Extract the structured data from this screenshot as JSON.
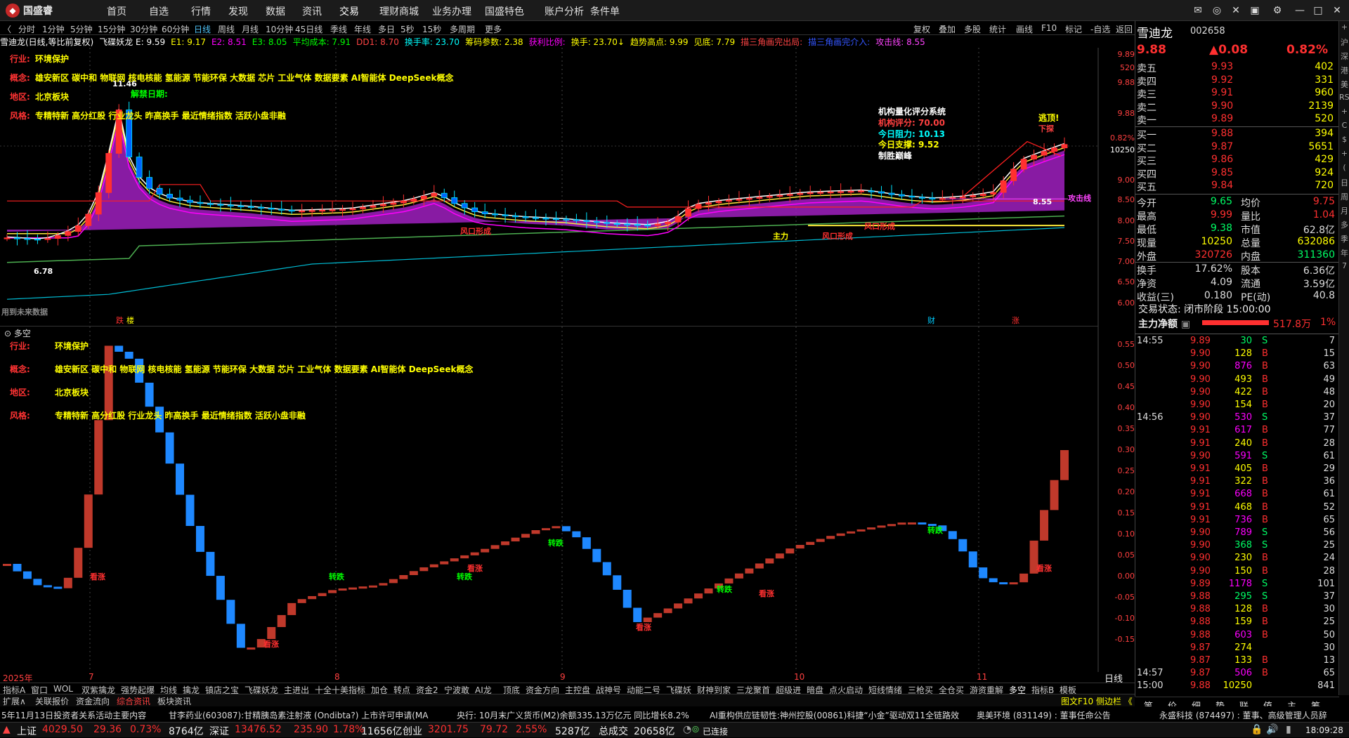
{
  "app": {
    "brand": "国盛睿",
    "menu": [
      "首页",
      "自选",
      "行情",
      "发现",
      "数据",
      "资讯",
      "交易",
      "理财商城",
      "业务办理",
      "国盛特色",
      "账户分析",
      "条件单"
    ],
    "active_menu": "交易"
  },
  "periods": [
    "分时",
    "1分钟",
    "5分钟",
    "15分钟",
    "30分钟",
    "60分钟",
    "日线",
    "周线",
    "月线",
    "10分钟",
    "45日线",
    "季线",
    "年线",
    "多日",
    "5秒",
    "15秒",
    "多周期",
    "更多"
  ],
  "active_period": "日线",
  "toolbar_right": [
    "复权",
    "叠加",
    "多股",
    "统计",
    "画线",
    "F10",
    "标记",
    "-自选",
    "返回"
  ],
  "indicator_line": [
    {
      "t": "雪迪龙(日线,等比前复权)",
      "c": "#ffffff"
    },
    {
      "t": "飞碟妖龙 E: 9.59",
      "c": "#ffffff"
    },
    {
      "t": "E1: 9.17",
      "c": "#ffff00"
    },
    {
      "t": "E2: 8.51",
      "c": "#ff00ff"
    },
    {
      "t": "E3: 8.05",
      "c": "#00ff00"
    },
    {
      "t": "平均成本: 7.91",
      "c": "#00ff00"
    },
    {
      "t": "DD1: 8.70",
      "c": "#ff4444"
    },
    {
      "t": "换手率: 23.70",
      "c": "#00ffff"
    },
    {
      "t": "筹码参数: 2.38",
      "c": "#ffff00"
    },
    {
      "t": "获利比例:",
      "c": "#ff00ff"
    },
    {
      "t": "换手: 23.70↓",
      "c": "#ffff00"
    },
    {
      "t": "趋势高点: 9.99",
      "c": "#ffff00"
    },
    {
      "t": "见底: 7.79",
      "c": "#ffff00"
    },
    {
      "t": "描三角画完出局:",
      "c": "#ff4444"
    },
    {
      "t": "描三角画完介入:",
      "c": "#3355ff"
    },
    {
      "t": "攻击线: 8.55",
      "c": "#ff44ff"
    }
  ],
  "info_main": [
    {
      "label": "行业:",
      "value": "环境保护"
    },
    {
      "label": "概念:",
      "value": "雄安新区 碳中和 物联网 核电核能 氢能源 节能环保 大数据 芯片 工业气体 数据要素 AI智能体 DeepSeek概念"
    },
    {
      "label": "地区:",
      "value": "北京板块"
    },
    {
      "label": "风格:",
      "value": "专精特新 高分红股 行业龙头 昨高换手 最近情绪指数 活跃小盘非融"
    }
  ],
  "info_lower": [
    {
      "label": "行业:",
      "value": "环境保护"
    },
    {
      "label": "概念:",
      "value": "雄安新区 碳中和 物联网 核电核能 氢能源 节能环保 大数据 芯片 工业气体 数据要素 AI智能体 DeepSeek概念"
    },
    {
      "label": "地区:",
      "value": "北京板块"
    },
    {
      "label": "风格:",
      "value": "专精特新 高分红股 行业龙头 昨高换手 最近情绪指数 活跃小盘非融"
    }
  ],
  "chart_labels": {
    "peak": "11.46",
    "chart_date": "解禁日期:",
    "low": "6.78",
    "rating_title": "机构量化评分系统",
    "rating": "机构评分: 70.00",
    "resist": "今日阻力: 10.13",
    "support": "今日支撑: 9.52",
    "win": "制胜巅峰",
    "escape": "逃顶!",
    "down": "下探",
    "pos": "8.55",
    "attack": "攻击线",
    "nodata": "用到未来数据",
    "wind1": "风口形成",
    "wind2": "风口形成",
    "wind3": "风口形成",
    "zhuli": "主力"
  },
  "main_axis": [
    "9.89",
    "520",
    "9.88",
    "9.88",
    "0.82%",
    "10250",
    "9.00",
    "8.50",
    "8.00",
    "7.50",
    "7.00",
    "6.50",
    "6.00"
  ],
  "lower_title": "多空",
  "lower_axis": [
    "0.55",
    "0.50",
    "0.45",
    "0.40",
    "0.35",
    "0.30",
    "0.25",
    "0.20",
    "0.15",
    "0.10",
    "0.05",
    "0.00",
    "-0.05",
    "-0.10",
    "-0.15"
  ],
  "x_axis": [
    "2025年",
    "7",
    "8",
    "9",
    "10",
    "11"
  ],
  "main_bottom_tags": [
    "跌",
    "楼",
    "财",
    "涨"
  ],
  "signals_lower": [
    "看涨",
    "转跌",
    "看涨",
    "转跌",
    "看涨",
    "转跌",
    "看涨",
    "转跌",
    "看涨",
    "转跌",
    "看涨"
  ],
  "stock": {
    "name": "雪迪龙",
    "code": "002658",
    "price": "9.88",
    "change": "▲0.08",
    "pct": "0.82%"
  },
  "order_book": {
    "asks": [
      [
        "卖五",
        "9.93",
        "402"
      ],
      [
        "卖四",
        "9.92",
        "331"
      ],
      [
        "卖三",
        "9.91",
        "960"
      ],
      [
        "卖二",
        "9.90",
        "2139"
      ],
      [
        "卖一",
        "9.89",
        "520"
      ]
    ],
    "bids": [
      [
        "买一",
        "9.88",
        "394"
      ],
      [
        "买二",
        "9.87",
        "5651"
      ],
      [
        "买三",
        "9.86",
        "429"
      ],
      [
        "买四",
        "9.85",
        "924"
      ],
      [
        "买五",
        "9.84",
        "720"
      ]
    ]
  },
  "stats": [
    [
      "今开",
      "9.65",
      "均价",
      "9.75"
    ],
    [
      "最高",
      "9.99",
      "量比",
      "1.04"
    ],
    [
      "最低",
      "9.38",
      "市值",
      "62.8亿"
    ],
    [
      "现量",
      "10250",
      "总量",
      "632086"
    ],
    [
      "外盘",
      "320726",
      "内盘",
      "311360"
    ],
    [
      "换手",
      "17.62%",
      "股本",
      "6.36亿"
    ],
    [
      "净资",
      "4.09",
      "流通",
      "3.59亿"
    ],
    [
      "收益(三)",
      "0.180",
      "PE(动)",
      "40.8"
    ]
  ],
  "trade_state": "交易状态: 闭市阶段 15:00:00",
  "main_net": {
    "label": "主力净额",
    "value": "517.8万",
    "pct": "1%"
  },
  "ticks": [
    [
      "14:55",
      "9.89",
      "30",
      "S",
      "7"
    ],
    [
      "",
      "9.90",
      "128",
      "B",
      "15"
    ],
    [
      "",
      "9.90",
      "876",
      "B",
      "63"
    ],
    [
      "",
      "9.90",
      "493",
      "B",
      "49"
    ],
    [
      "",
      "9.90",
      "422",
      "B",
      "48"
    ],
    [
      "",
      "9.90",
      "154",
      "B",
      "20"
    ],
    [
      "14:56",
      "9.90",
      "530",
      "S",
      "37"
    ],
    [
      "",
      "9.91",
      "617",
      "B",
      "77"
    ],
    [
      "",
      "9.91",
      "240",
      "B",
      "28"
    ],
    [
      "",
      "9.90",
      "591",
      "S",
      "61"
    ],
    [
      "",
      "9.91",
      "405",
      "B",
      "29"
    ],
    [
      "",
      "9.91",
      "322",
      "B",
      "36"
    ],
    [
      "",
      "9.91",
      "668",
      "B",
      "61"
    ],
    [
      "",
      "9.91",
      "468",
      "B",
      "52"
    ],
    [
      "",
      "9.91",
      "736",
      "B",
      "65"
    ],
    [
      "",
      "9.90",
      "789",
      "S",
      "56"
    ],
    [
      "",
      "9.90",
      "368",
      "S",
      "25"
    ],
    [
      "",
      "9.90",
      "230",
      "B",
      "24"
    ],
    [
      "",
      "9.90",
      "150",
      "B",
      "28"
    ],
    [
      "",
      "9.89",
      "1178",
      "S",
      "101"
    ],
    [
      "",
      "9.88",
      "295",
      "S",
      "37"
    ],
    [
      "",
      "9.88",
      "128",
      "B",
      "30"
    ],
    [
      "",
      "9.88",
      "159",
      "B",
      "25"
    ],
    [
      "",
      "9.88",
      "603",
      "B",
      "50"
    ],
    [
      "",
      "9.87",
      "274",
      "",
      "30"
    ],
    [
      "",
      "9.87",
      "133",
      "B",
      "13"
    ],
    [
      "14:57",
      "9.87",
      "506",
      "B",
      "65"
    ],
    [
      "15:00",
      "9.88",
      "10250",
      "",
      "841"
    ]
  ],
  "right_side_tabs": [
    "笔",
    "价",
    "细",
    "势",
    "联",
    "值",
    "主",
    "筹"
  ],
  "right_strip": [
    "+",
    "沪",
    "深",
    "港",
    "美",
    "RSI",
    "+",
    "C",
    "$",
    "+",
    "(",
    "日",
    "周",
    "月",
    "多",
    "季",
    "年",
    "7"
  ],
  "bottom_tabs": [
    "指标A",
    "窗口",
    "WOL",
    "双紫擒龙",
    "强势起爆",
    "均线",
    "擒龙",
    "镇店之宝",
    "飞碟妖龙",
    "主进出",
    "十全十美指标",
    "加仓",
    "转点",
    "资金2",
    "宁波敢",
    "AI龙",
    "顶底",
    "资金方向",
    "主控盘",
    "战神号",
    "动能二号",
    "飞碟妖",
    "财神到家",
    "三龙聚首",
    "超级进",
    "暗盘",
    "点火启动",
    "短线情绪",
    "三枪买",
    "全仓买",
    "游资重解",
    "多空",
    "指标B",
    "模板"
  ],
  "tabs2": [
    "扩展∧",
    "关联报价",
    "资金流向",
    "综合资讯",
    "板块资讯"
  ],
  "tabs2_right": "图文F10 侧边栏 《",
  "period_right": "日线",
  "news": [
    "5年11月13日投资者关系活动主要内容",
    "甘李药业(603087):甘精胰岛素注射液 (Ondibta?) 上市许可申请(MA",
    "央行: 10月末广义货币(M2)余额335.13万亿元 同比增长8.2%",
    "AI重构供应链韧性:神州控股(00861)科捷“小金”驱动双11全链路效",
    "奥美环境 (831149) : 董事任命公告",
    "永盛科技 (874497) : 董事、高级管理人员辞"
  ],
  "status": {
    "sh_label": "上证",
    "sh": "4029.50",
    "sh_chg": "29.36",
    "sh_pct": "0.73%",
    "sh_amt": "8764亿",
    "sz_label": "深证",
    "sz": "13476.52",
    "sz_chg": "235.90",
    "sz_pct": "1.78%",
    "sz_amt": "11656亿",
    "cy_label": "创业",
    "cy": "3201.75",
    "cy_chg": "79.72",
    "cy_pct": "2.55%",
    "cy_amt": "5287亿",
    "total_label": "总成交",
    "total": "20658亿",
    "conn": "已连接",
    "time": "18:09:28"
  }
}
